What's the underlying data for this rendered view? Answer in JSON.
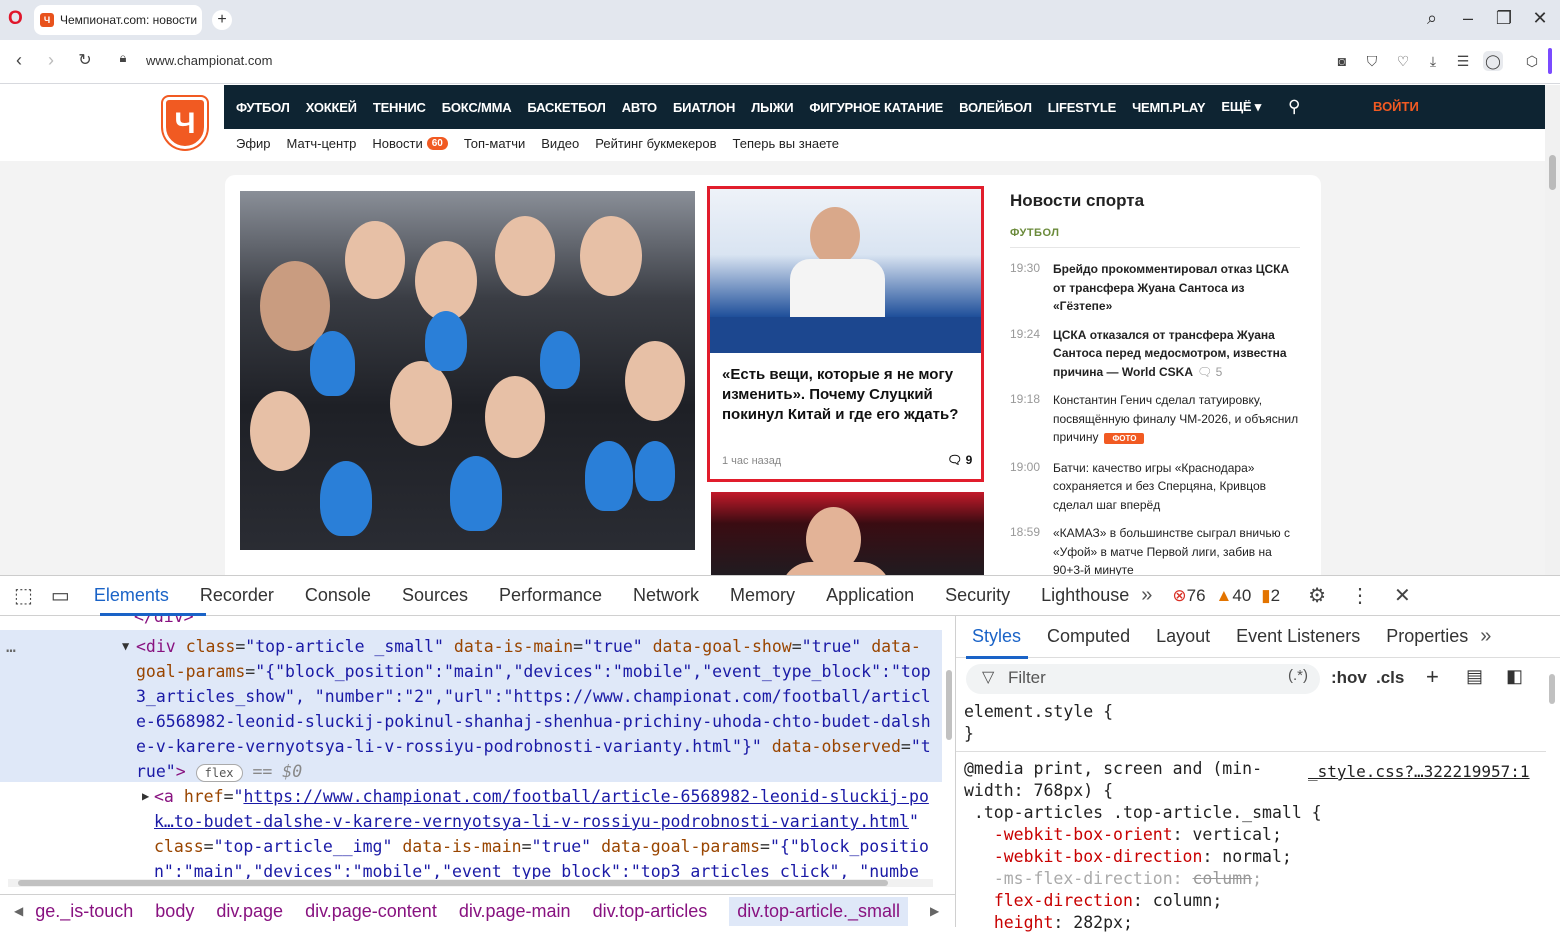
{
  "browser": {
    "tab_title": "Чемпионат.com: новости",
    "url": "www.championat.com"
  },
  "site": {
    "logo_letter": "Ч",
    "nav": [
      "ФУТБОЛ",
      "ХОККЕЙ",
      "ТЕННИС",
      "БОКС/ММА",
      "БАСКЕТБОЛ",
      "АВТО",
      "БИАТЛОН",
      "ЛЫЖИ",
      "ФИГУРНОЕ КАТАНИЕ",
      "ВОЛЕЙБОЛ",
      "LIFESTYLE",
      "ЧЕМП.PLAY",
      "ЕЩЁ ▾"
    ],
    "login": "ВОЙТИ",
    "subnav": [
      "Эфир",
      "Матч-центр",
      "Новости",
      "Топ-матчи",
      "Видео",
      "Рейтинг букмекеров",
      "Теперь вы знаете"
    ],
    "news_badge": "60",
    "highlight": {
      "title": "«Есть вещи, которые я не могу изменить». Почему Слуцкий покинул Китай и где его ждать?",
      "time": "1 час назад",
      "comments": "9"
    },
    "news": {
      "heading": "Новости спорта",
      "category": "ФУТБОЛ",
      "items": [
        {
          "time": "19:30",
          "text": "Брейдо прокомментировал отказ ЦСКА от трансфера Жуана Сантоса из «Гёзтепе»",
          "bold": true,
          "count": "",
          "foto": ""
        },
        {
          "time": "19:24",
          "text": "ЦСКА отказался от трансфера Жуана Сантоса перед медосмотром, известна причина — World CSKA",
          "bold": true,
          "count": "5",
          "foto": ""
        },
        {
          "time": "19:18",
          "text": "Константин Генич сделал татуировку, посвящённую финалу ЧМ-2026, и объяснил причину",
          "bold": false,
          "count": "",
          "foto": "ФОТО"
        },
        {
          "time": "19:00",
          "text": "Батчи: качество игры «Краснодара» сохраняется и без Сперцяна, Кривцов сделал шаг вперёд",
          "bold": false,
          "count": "",
          "foto": ""
        },
        {
          "time": "18:59",
          "text": "«КАМАЗ» в большинстве сыграл вничью с «Уфой» в матче Первой лиги, забив на 90+3-й минуте",
          "bold": false,
          "count": "",
          "foto": ""
        }
      ]
    }
  },
  "devtools": {
    "tabs": [
      "Elements",
      "Recorder",
      "Console",
      "Sources",
      "Performance",
      "Network",
      "Memory",
      "Application",
      "Security",
      "Lighthouse"
    ],
    "errors": "76",
    "warnings": "40",
    "issues": "2",
    "breadcrumbs": [
      "ge._is-touch",
      "body",
      "div.page",
      "div.page-content",
      "div.page-main",
      "div.top-articles",
      "div.top-article._small"
    ],
    "styles_tabs": [
      "Styles",
      "Computed",
      "Layout",
      "Event Listeners",
      "Properties"
    ],
    "filter_placeholder": "Filter",
    "filter_regex": "(.*)",
    "hov": ":hov",
    "cls": ".cls",
    "source_link": "_style.css?…322219957:1",
    "flex_pill": "flex",
    "eq0": "== $0"
  }
}
